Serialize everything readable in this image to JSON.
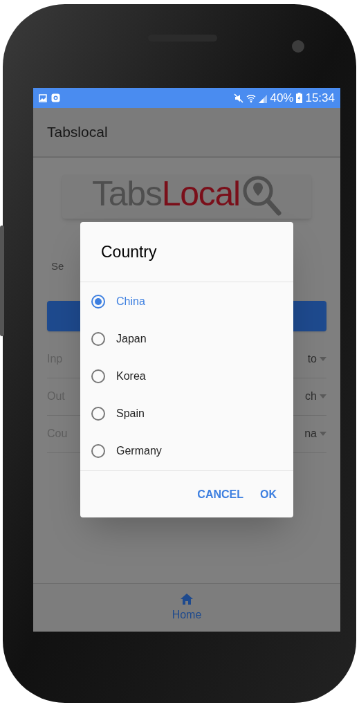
{
  "status_bar": {
    "battery": "40%",
    "time": "15:34"
  },
  "app_bar": {
    "title": "Tabslocal"
  },
  "logo": {
    "part_1": "Tabs",
    "part_2": "Local"
  },
  "search_hint": "Se",
  "settings_rows": [
    {
      "label": "Inp",
      "value": "to"
    },
    {
      "label": "Out",
      "value": "ch"
    },
    {
      "label": "Cou",
      "value": "na"
    }
  ],
  "dialog": {
    "title": "Country",
    "options": [
      {
        "label": "China",
        "selected": true
      },
      {
        "label": "Japan",
        "selected": false
      },
      {
        "label": "Korea",
        "selected": false
      },
      {
        "label": "Spain",
        "selected": false
      },
      {
        "label": "Germany",
        "selected": false
      }
    ],
    "buttons": [
      "CANCEL",
      "OK"
    ]
  },
  "bottom_nav": [
    {
      "label": "Home",
      "selected": true
    }
  ]
}
